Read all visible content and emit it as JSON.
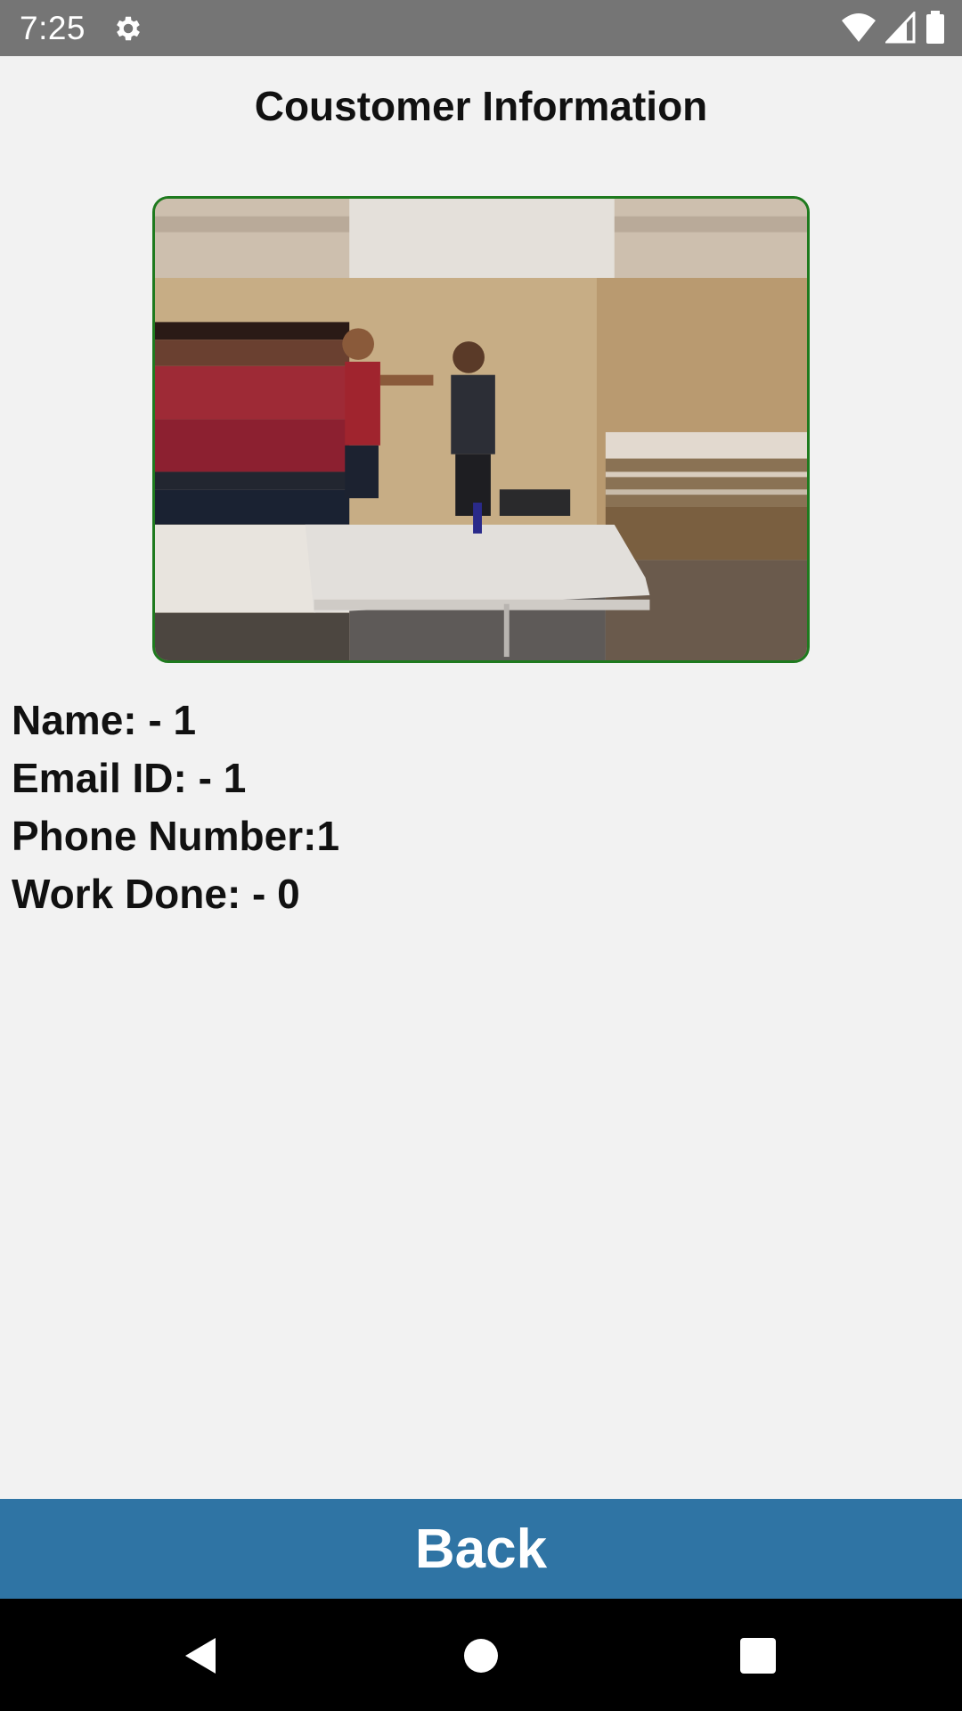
{
  "status_bar": {
    "time": "7:25",
    "icons": [
      "settings-gear-icon",
      "wifi-icon",
      "cell-signal-icon",
      "battery-icon"
    ]
  },
  "page": {
    "title": "Coustomer Information"
  },
  "photo": {
    "description_icon": "customer-photo"
  },
  "info": {
    "name": "Name: - 1",
    "email": "Email ID: - 1",
    "phone": "Phone Number:1",
    "work_done": "Work Done: - 0"
  },
  "actions": {
    "back_label": "Back"
  },
  "nav_bar": {
    "icons": [
      "back-triangle-icon",
      "home-circle-icon",
      "recents-square-icon"
    ]
  },
  "colors": {
    "status_bar": "#757575",
    "background": "#f2f2f2",
    "frame_border": "#1e7a1e",
    "back_button": "#2f74a4",
    "nav_bar": "#000000"
  }
}
